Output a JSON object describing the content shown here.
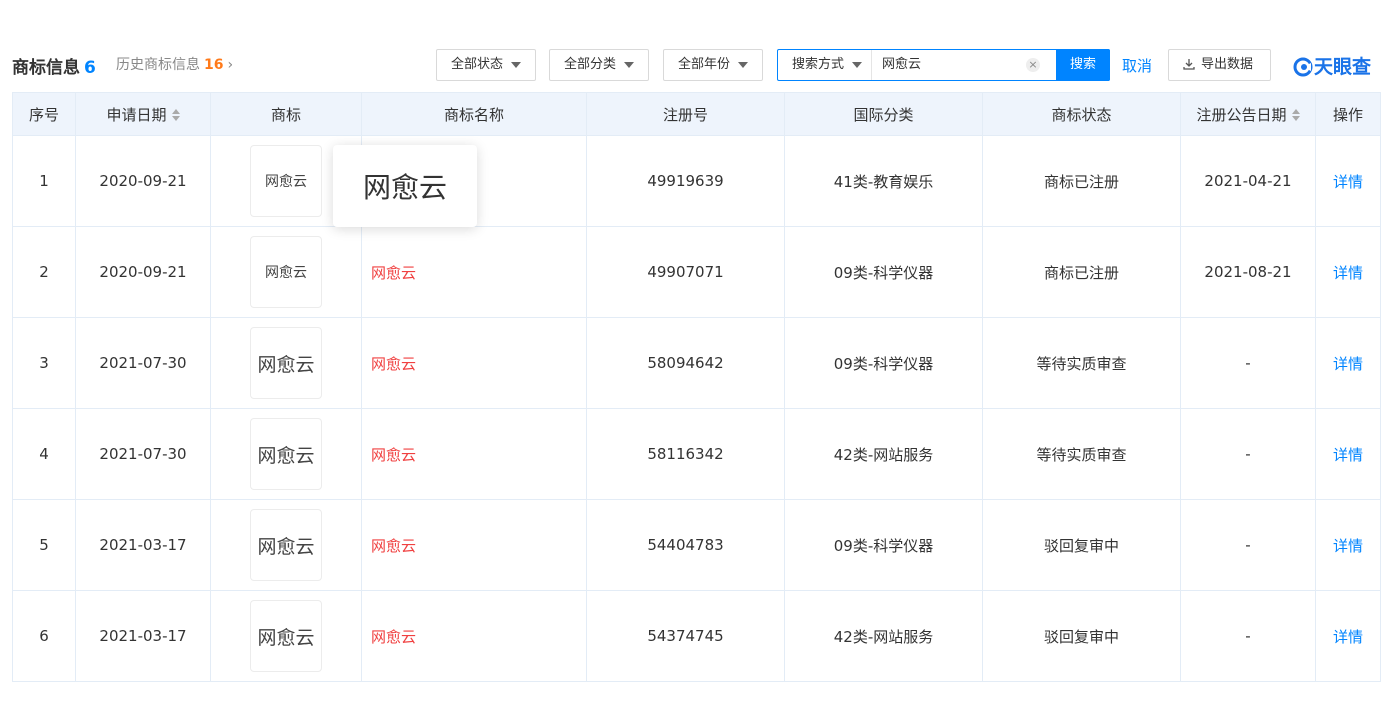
{
  "header": {
    "title": "商标信息",
    "count": "6",
    "history_label": "历史商标信息",
    "history_count": "16",
    "history_arrow": "›"
  },
  "filters": {
    "status": "全部状态",
    "category": "全部分类",
    "year": "全部年份"
  },
  "search": {
    "mode": "搜索方式",
    "value": "网愈云",
    "clear": "×",
    "button": "搜索"
  },
  "actions": {
    "cancel": "取消",
    "export": "导出数据"
  },
  "logo": {
    "text": "天眼查",
    "color": "#1a73e8"
  },
  "colors": {
    "accent": "#0084ff",
    "name_red": "#f04040",
    "header_bg": "#eef4fc",
    "history_count": "#ff7a1a"
  },
  "table": {
    "headers": [
      "序号",
      "申请日期",
      "商标",
      "商标名称",
      "注册号",
      "国际分类",
      "商标状态",
      "注册公告日期",
      "操作"
    ],
    "rows": [
      {
        "index": "1",
        "date": "2020-09-21",
        "image_text": "网愈云",
        "name": "",
        "reg_no": "49919639",
        "class": "41类-教育娱乐",
        "status": "商标已注册",
        "pub_date": "2021-04-21",
        "action": "详情"
      },
      {
        "index": "2",
        "date": "2020-09-21",
        "image_text": "网愈云",
        "name": "网愈云",
        "reg_no": "49907071",
        "class": "09类-科学仪器",
        "status": "商标已注册",
        "pub_date": "2021-08-21",
        "action": "详情"
      },
      {
        "index": "3",
        "date": "2021-07-30",
        "image_text": "网愈云",
        "name": "网愈云",
        "reg_no": "58094642",
        "class": "09类-科学仪器",
        "status": "等待实质审查",
        "pub_date": "-",
        "action": "详情"
      },
      {
        "index": "4",
        "date": "2021-07-30",
        "image_text": "网愈云",
        "name": "网愈云",
        "reg_no": "58116342",
        "class": "42类-网站服务",
        "status": "等待实质审查",
        "pub_date": "-",
        "action": "详情"
      },
      {
        "index": "5",
        "date": "2021-03-17",
        "image_text": "网愈云",
        "name": "网愈云",
        "reg_no": "54404783",
        "class": "09类-科学仪器",
        "status": "驳回复审中",
        "pub_date": "-",
        "action": "详情"
      },
      {
        "index": "6",
        "date": "2021-03-17",
        "image_text": "网愈云",
        "name": "网愈云",
        "reg_no": "54374745",
        "class": "42类-网站服务",
        "status": "驳回复审中",
        "pub_date": "-",
        "action": "详情"
      }
    ]
  },
  "popup": {
    "text": "网愈云"
  }
}
